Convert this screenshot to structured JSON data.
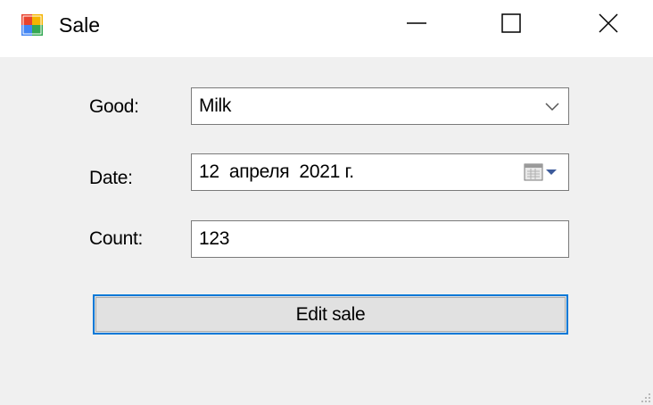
{
  "window": {
    "title": "Sale",
    "icon": "app-form-icon",
    "controls": {
      "minimize": "minimize-icon",
      "maximize": "maximize-icon",
      "close": "close-icon"
    }
  },
  "form": {
    "good": {
      "label": "Good:",
      "value": "Milk",
      "icon": "chevron-down-icon"
    },
    "date": {
      "label": "Date:",
      "value": "12  апреля  2021 г.",
      "icon": "calendar-icon"
    },
    "count": {
      "label": "Count:",
      "value": "123"
    },
    "submit_label": "Edit sale"
  },
  "colors": {
    "client_background": "#f0f0f0",
    "focus_border": "#0078d7",
    "button_face": "#e1e1e1",
    "field_border": "#7a7a7a"
  }
}
